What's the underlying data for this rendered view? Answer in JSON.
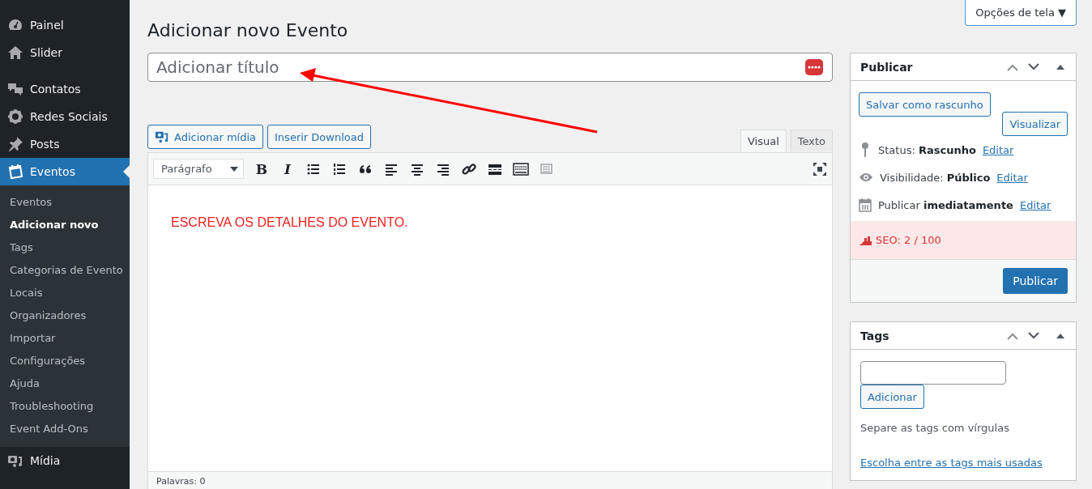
{
  "sidebar": {
    "items": [
      {
        "label": "Painel",
        "selected": false
      },
      {
        "label": "Slider",
        "selected": false
      },
      {
        "label": "Contatos",
        "selected": false
      },
      {
        "label": "Redes Sociais",
        "selected": false
      },
      {
        "label": "Posts",
        "selected": false
      },
      {
        "label": "Eventos",
        "selected": true,
        "submenu": [
          {
            "label": "Eventos",
            "selected": false
          },
          {
            "label": "Adicionar novo",
            "selected": true
          },
          {
            "label": "Tags",
            "selected": false
          },
          {
            "label": "Categorias de Evento",
            "selected": false
          },
          {
            "label": "Locais",
            "selected": false
          },
          {
            "label": "Organizadores",
            "selected": false
          },
          {
            "label": "Importar",
            "selected": false
          },
          {
            "label": "Configurações",
            "selected": false
          },
          {
            "label": "Ajuda",
            "selected": false
          },
          {
            "label": "Troubleshooting",
            "selected": false
          },
          {
            "label": "Event Add-Ons",
            "selected": false
          }
        ]
      },
      {
        "label": "Mídia",
        "selected": false
      }
    ]
  },
  "screen_options": "Opções de tela ▼",
  "page_title": "Adicionar novo Evento",
  "title_field": {
    "placeholder": "Adicionar título"
  },
  "media_buttons": [
    "Adicionar mídia",
    "Inserir Download"
  ],
  "editor_tabs": [
    {
      "label": "Visual",
      "selected": true
    },
    {
      "label": "Texto",
      "selected": false
    }
  ],
  "format_select": "Parágrafo",
  "format_buttons": [
    "B",
    "I"
  ],
  "content": "ESCREVA OS DETALHES DO EVENTO.",
  "word_count": "Palavras: 0",
  "publish_box": {
    "title": "Publicar",
    "save_draft": "Salvar como rascunho",
    "preview": "Visualizar",
    "rows": [
      {
        "label": "Status:",
        "value": "Rascunho",
        "link": "Editar"
      },
      {
        "label": "Visibilidade:",
        "value": "Público",
        "link": "Editar"
      },
      {
        "label": "Publicar",
        "value": "imediatamente",
        "link": "Editar"
      }
    ],
    "seo": "SEO: 2 / 100",
    "publish": "Publicar"
  },
  "tags_box": {
    "title": "Tags",
    "add": "Adicionar",
    "hint": "Separe as tags com vírgulas",
    "link": "Escolha entre as tags mais usadas"
  }
}
